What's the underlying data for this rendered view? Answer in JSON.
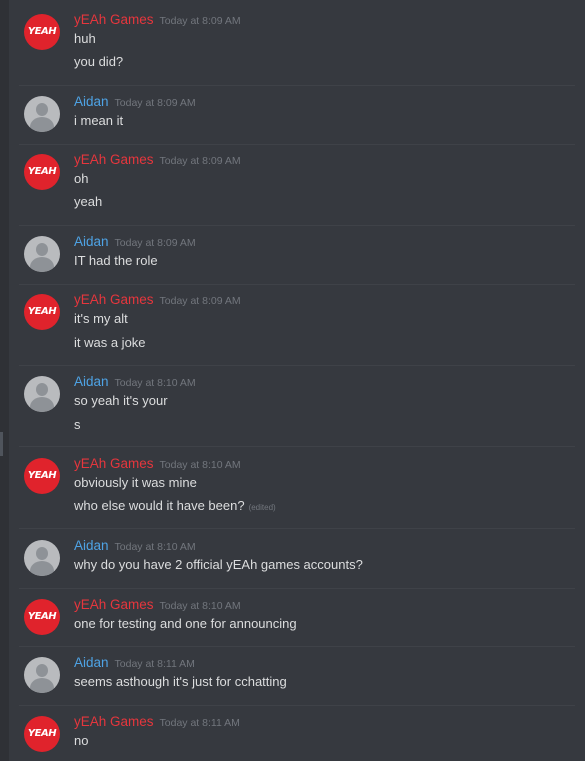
{
  "users": {
    "yeah": {
      "name": "yEAh Games",
      "avatar_text": "YEAH"
    },
    "aidan": {
      "name": "Aidan"
    }
  },
  "colors": {
    "background": "#36393f",
    "yeah_name": "#e6363d",
    "aidan_name": "#4ea3e5",
    "message_text": "#dcddde",
    "timestamp": "#72767d"
  },
  "groups": [
    {
      "author": "yEAh Games",
      "time": "Today at 8:09 AM",
      "messages": [
        "huh",
        "you did?"
      ]
    },
    {
      "author": "Aidan",
      "time": "Today at 8:09 AM",
      "messages": [
        "i mean it"
      ]
    },
    {
      "author": "yEAh Games",
      "time": "Today at 8:09 AM",
      "messages": [
        "oh",
        "yeah"
      ]
    },
    {
      "author": "Aidan",
      "time": "Today at 8:09 AM",
      "messages": [
        "IT had the role"
      ]
    },
    {
      "author": "yEAh Games",
      "time": "Today at 8:09 AM",
      "messages": [
        "it's my alt",
        "it was a joke"
      ]
    },
    {
      "author": "Aidan",
      "time": "Today at 8:10 AM",
      "messages": [
        "so yeah it's your",
        "s"
      ]
    },
    {
      "author": "yEAh Games",
      "time": "Today at 8:10 AM",
      "messages": [
        "obviously it was mine",
        "who else would it have been?"
      ],
      "edited_label": "(edited)"
    },
    {
      "author": "Aidan",
      "time": "Today at 8:10 AM",
      "messages": [
        "why do you have 2 official yEAh games accounts?"
      ]
    },
    {
      "author": "yEAh Games",
      "time": "Today at 8:10 AM",
      "messages": [
        "one for testing and one for announcing"
      ]
    },
    {
      "author": "Aidan",
      "time": "Today at 8:11 AM",
      "messages": [
        "seems asthough it's just for cchatting"
      ]
    },
    {
      "author": "yEAh Games",
      "time": "Today at 8:11 AM",
      "messages": [
        "no"
      ]
    }
  ]
}
